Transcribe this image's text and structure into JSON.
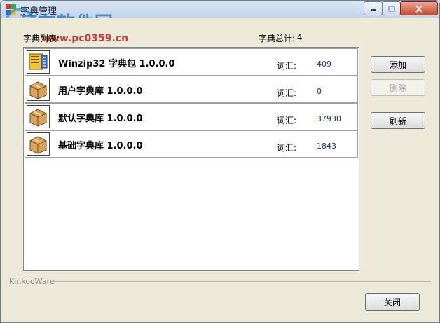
{
  "window": {
    "title": "字典管理"
  },
  "watermark": {
    "logo": "河东软件园",
    "url": "www.pc0359.cn"
  },
  "header": {
    "list_label": "字典列表:",
    "total_label": "字典总计:",
    "total_value": "4"
  },
  "dictionaries": [
    {
      "name": "Winzip32 字典包 1.0.0.0",
      "count_label": "词汇:",
      "count": "409",
      "icon": "winzip-package-icon"
    },
    {
      "name": "用户字典库 1.0.0.0",
      "count_label": "词汇:",
      "count": "0",
      "icon": "box-icon"
    },
    {
      "name": "默认字典库 1.0.0.0",
      "count_label": "词汇:",
      "count": "37930",
      "icon": "box-icon"
    },
    {
      "name": "基础字典库 1.0.0.0",
      "count_label": "词汇:",
      "count": "1843",
      "icon": "box-icon"
    }
  ],
  "buttons": {
    "add": "添加",
    "delete": "删除",
    "refresh": "刷新",
    "close": "关闭"
  },
  "footer": {
    "brand": "KinkooWare"
  },
  "colors": {
    "count_text": "#1e2fa0",
    "title_bar": "#c2d3ea",
    "window_bg": "#ece9d8"
  }
}
